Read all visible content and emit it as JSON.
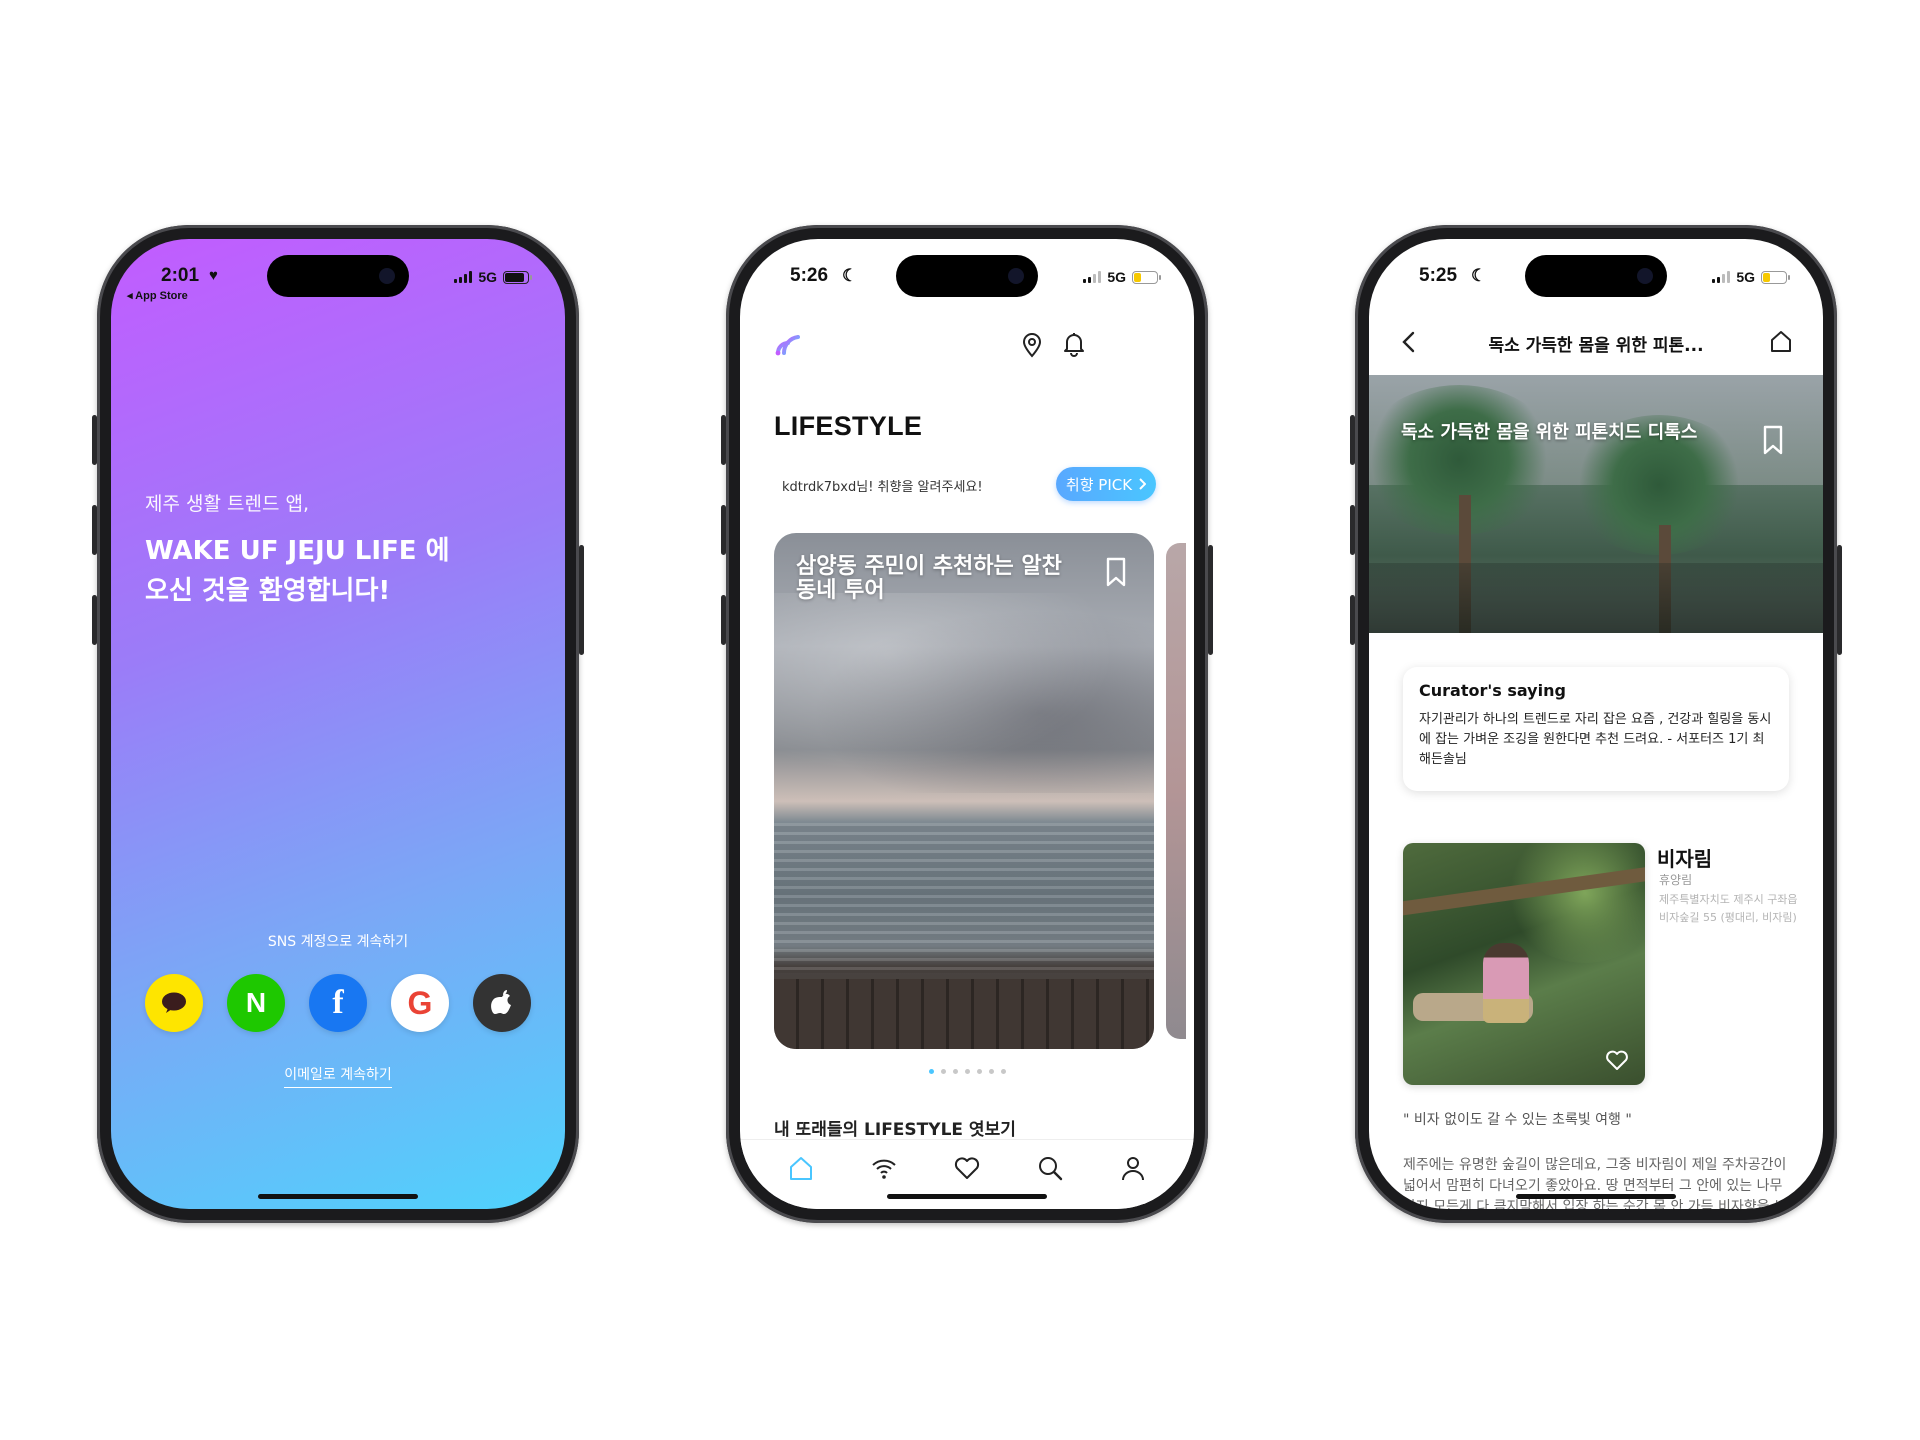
{
  "phone1": {
    "status": {
      "time": "2:01",
      "back_app": "◂ App Store",
      "network": "5G",
      "battery_level": 0.95
    },
    "welcome": {
      "line1": "제주 생활 트렌드 앱,",
      "line2": "WAKE UF JEJU LIFE 에",
      "line3": "오신 것을 환영합니다!"
    },
    "sns_label": "SNS 계정으로 계속하기",
    "sns_buttons": [
      {
        "name": "kakao",
        "icon": "speech-bubble-icon"
      },
      {
        "name": "naver",
        "glyph": "N"
      },
      {
        "name": "facebook",
        "glyph": "f"
      },
      {
        "name": "google",
        "glyph": "G"
      },
      {
        "name": "apple",
        "icon": "apple-icon"
      }
    ],
    "email_link": "이메일로 계속하기"
  },
  "phone2": {
    "status": {
      "time": "5:26",
      "network": "5G",
      "battery_level": 0.35,
      "battery_color": "#f7c900"
    },
    "title": "LIFESTYLE",
    "pick_message": "kdtrdk7bxd님! 취향을 알려주세요!",
    "pick_button": "취향 PICK",
    "card_title": "삼양동 주민이 추천하는 알찬 동네 투어",
    "carousel": {
      "count": 7,
      "active_index": 0
    },
    "neighbors_heading": "내 또래들의 LIFESTYLE 엿보기",
    "tabs": [
      "home-icon",
      "wifi-icon",
      "heart-icon",
      "search-icon",
      "profile-icon"
    ],
    "accent": "#4ac6ff"
  },
  "phone3": {
    "status": {
      "time": "5:25",
      "network": "5G",
      "battery_level": 0.35,
      "battery_color": "#f7c900"
    },
    "nav_title": "독소 가득한 몸을 위한 피톤...",
    "hero_title": "독소 가득한 몸을 위한 피톤치드 디톡스",
    "curator_heading": "Curator's saying",
    "curator_text": "자기관리가 하나의 트렌드로 자리 잡은 요즘 , 건강과 힐링을 동시에 잡는 가벼운 조깅을 원한다면 추천 드려요.  - 서포터즈 1기 최해든솔님",
    "place": {
      "name": "비자림",
      "category": "휴양림",
      "address": "제주특별자치도 제주시 구좌읍 비자숲길 55 (평대리, 비자림)"
    },
    "quote": "\" 비자 없이도 갈 수 있는 초록빛 여행 \"",
    "description": "제주에는 유명한 숲길이 많은데요, 그중 비자림이 제일 주차공간이 넓어서 맘편히 다녀오기 좋았아요. 땅 면적부터 그 안에 있는 나무까지 모든게 다 큼지막해서 입장 하는 순간 몸 안 가득 비자향을 느낄 수 있어요"
  }
}
